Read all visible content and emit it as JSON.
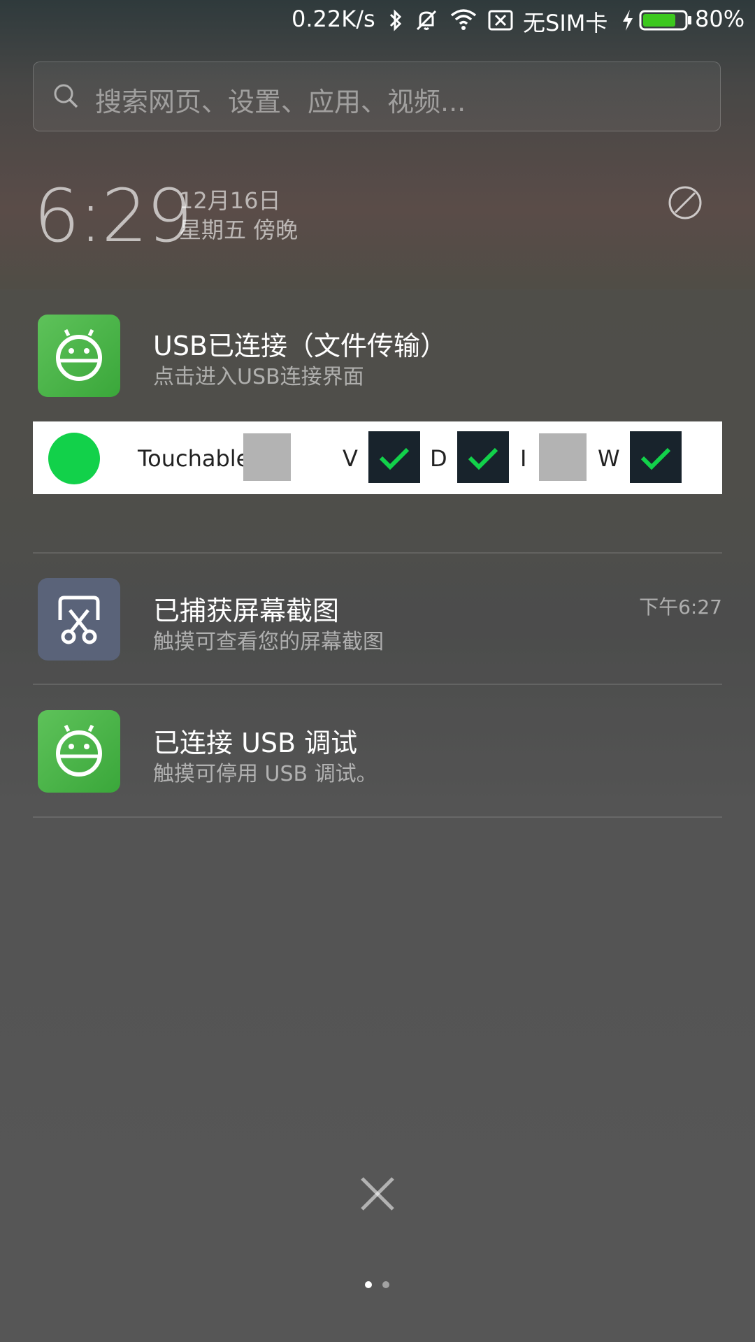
{
  "status_bar": {
    "net_speed": "0.22K/s",
    "sim": "无SIM卡",
    "battery_percent": "80%",
    "battery_level": 0.8,
    "icons": [
      "bluetooth-icon",
      "mute-icon",
      "wifi-icon",
      "no-data-icon",
      "charging-icon",
      "battery-icon"
    ]
  },
  "search": {
    "placeholder": "搜索网页、设置、应用、视频..."
  },
  "clock": {
    "time": "6:29",
    "date": "12月16日",
    "weekday": "星期五 傍晚"
  },
  "notifications": [
    {
      "title": "USB已连接（文件传输）",
      "subtitle": "点击进入USB连接界面",
      "time": ""
    },
    {
      "title": "已捕获屏幕截图",
      "subtitle": "触摸可查看您的屏幕截图",
      "time": "下午6:27"
    },
    {
      "title": "已连接 USB 调试",
      "subtitle": "触摸可停用 USB 调试。",
      "time": ""
    }
  ],
  "toggles": {
    "touchable_label": "Touchable",
    "items": [
      {
        "label": "V",
        "checked": true
      },
      {
        "label": "D",
        "checked": true
      },
      {
        "label": "I",
        "checked": false
      },
      {
        "label": "W",
        "checked": true
      }
    ]
  },
  "colors": {
    "accent_green": "#12d14a",
    "app_green": "#4cb648",
    "check_bg": "#18232c"
  }
}
